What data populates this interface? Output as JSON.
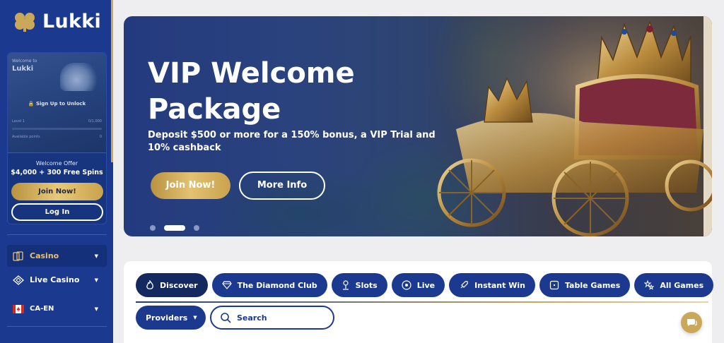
{
  "brand": {
    "name": "Lukki"
  },
  "sidebar": {
    "welcome": {
      "small_label": "Welcome to",
      "name": "Lukki",
      "unlock_text": "Sign Up to Unlock",
      "level_label": "Level 1",
      "level_value": "0/1,000",
      "available_label": "Available points",
      "available_value": "0"
    },
    "offer_label": "Welcome Offer",
    "offer_value": "$4,000 + 300 Free Spins",
    "join_label": "Join Now!",
    "login_label": "Log In",
    "nav": [
      {
        "label": "Casino",
        "icon": "cards-icon",
        "active": true
      },
      {
        "label": "Live Casino",
        "icon": "diamond-icon",
        "active": false
      },
      {
        "label": "CA-EN",
        "icon": "canada-flag-icon",
        "active": false
      }
    ]
  },
  "banner": {
    "title": "VIP Welcome Package",
    "description_prefix": "Deposit ",
    "description_amount": "$500",
    "description_suffix": " or more for a 150% bonus, a VIP Trial and 10% cashback",
    "join_label": "Join Now!",
    "more_label": "More Info",
    "slides_total": 3,
    "slide_active": 2
  },
  "games": {
    "tabs": [
      {
        "label": "Discover",
        "icon": "fire-icon",
        "active": true
      },
      {
        "label": "The Diamond Club",
        "icon": "diamond-icon",
        "active": false
      },
      {
        "label": "Slots",
        "icon": "joystick-icon",
        "active": false
      },
      {
        "label": "Live",
        "icon": "chip-icon",
        "active": false
      },
      {
        "label": "Instant Win",
        "icon": "rocket-icon",
        "active": false
      },
      {
        "label": "Table Games",
        "icon": "table-icon",
        "active": false
      },
      {
        "label": "All Games",
        "icon": "stars-icon",
        "active": false
      }
    ],
    "providers_label": "Providers",
    "search_placeholder": "Search"
  },
  "colors": {
    "primary": "#1b3a8f",
    "gold": "#c9a85a",
    "background": "#eeeef0"
  }
}
